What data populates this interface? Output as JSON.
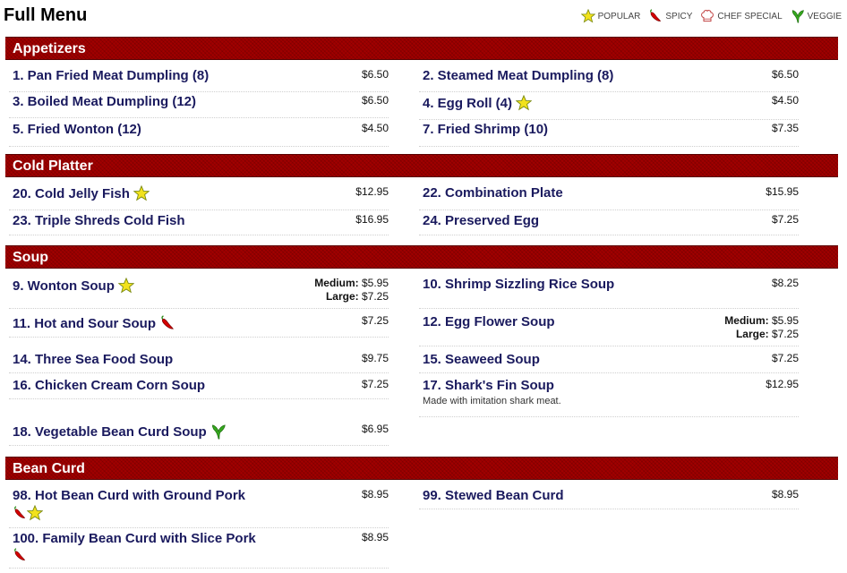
{
  "page_title": "Full Menu",
  "legend": [
    {
      "icon": "star-icon",
      "label": "POPULAR"
    },
    {
      "icon": "chili-pepper-icon",
      "label": "SPICY"
    },
    {
      "icon": "chef-hat-icon",
      "label": "CHEF SPECIAL"
    },
    {
      "icon": "leaf-icon",
      "label": "VEGGIE"
    }
  ],
  "colors": {
    "section_bar": "#a10000",
    "item_name": "#1a1a5e",
    "star": "#f2e21c",
    "spicy": "#d40000",
    "veggie": "#35a81e"
  },
  "sections": {
    "appetizers": {
      "title": "Appetizers",
      "items": [
        {
          "name": "1. Pan Fried Meat Dumpling (8)",
          "price": "$6.50"
        },
        {
          "name": "2. Steamed Meat Dumpling (8)",
          "price": "$6.50"
        },
        {
          "name": "3. Boiled Meat Dumpling (12)",
          "price": "$6.50"
        },
        {
          "name": "4. Egg Roll (4)",
          "price": "$4.50",
          "icons": [
            "star-icon"
          ]
        },
        {
          "name": "5. Fried Wonton (12)",
          "price": "$4.50"
        },
        {
          "name": "7. Fried Shrimp (10)",
          "price": "$7.35"
        }
      ]
    },
    "cold_platter": {
      "title": "Cold Platter",
      "items": [
        {
          "name": "20. Cold Jelly Fish",
          "price": "$12.95",
          "icons": [
            "star-icon"
          ]
        },
        {
          "name": "22. Combination Plate",
          "price": "$15.95"
        },
        {
          "name": "23. Triple Shreds Cold Fish",
          "price": "$16.95"
        },
        {
          "name": "24. Preserved Egg",
          "price": "$7.25"
        }
      ]
    },
    "soup": {
      "title": "Soup",
      "items": [
        {
          "name": "9. Wonton Soup",
          "icons": [
            "star-icon"
          ],
          "medium_label": "Medium:",
          "medium_price": "$5.95",
          "large_label": "Large:",
          "large_price": "$7.25"
        },
        {
          "name": "10. Shrimp Sizzling Rice Soup",
          "price": "$8.25"
        },
        {
          "name": "11. Hot and Sour Soup",
          "price": "$7.25",
          "icons": [
            "chili-pepper-icon"
          ]
        },
        {
          "name": "12. Egg Flower Soup",
          "medium_label": "Medium:",
          "medium_price": "$5.95",
          "large_label": "Large:",
          "large_price": "$7.25"
        },
        {
          "name": "14. Three Sea Food Soup",
          "price": "$9.75"
        },
        {
          "name": "15. Seaweed Soup",
          "price": "$7.25"
        },
        {
          "name": "16. Chicken Cream Corn Soup",
          "price": "$7.25"
        },
        {
          "name": "17. Shark's Fin Soup",
          "price": "$12.95",
          "note": "Made with imitation shark meat."
        },
        {
          "name": "18. Vegetable Bean Curd Soup",
          "price": "$6.95",
          "icons": [
            "leaf-icon"
          ]
        }
      ]
    },
    "bean_curd": {
      "title": "Bean Curd",
      "items": [
        {
          "name": "98. Hot Bean Curd with Ground Pork",
          "price": "$8.95",
          "icons": [
            "chili-pepper-icon",
            "star-icon"
          ]
        },
        {
          "name": "99. Stewed Bean Curd",
          "price": "$8.95"
        },
        {
          "name": "100. Family Bean Curd with Slice Pork",
          "price": "$8.95",
          "icons": [
            "chili-pepper-icon"
          ]
        }
      ]
    }
  }
}
